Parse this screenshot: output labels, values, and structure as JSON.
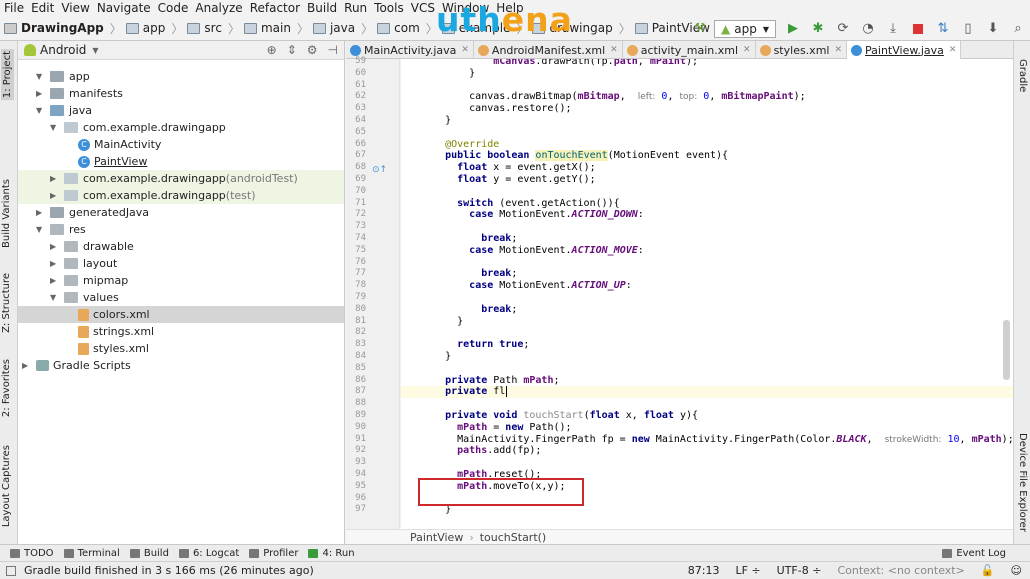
{
  "menubar": [
    "File",
    "Edit",
    "View",
    "Navigate",
    "Code",
    "Analyze",
    "Refactor",
    "Build",
    "Run",
    "Tools",
    "VCS",
    "Window",
    "Help"
  ],
  "breadcrumbs": [
    "DrawingApp",
    "app",
    "src",
    "main",
    "java",
    "com",
    "example",
    "drawingap",
    "PaintView"
  ],
  "logo": {
    "part1": "uth",
    "part2": "ena"
  },
  "run_config": "app",
  "left_tabs": [
    "1: Project",
    "Build Variants",
    "Z: Structure",
    "2: Favorites",
    "Layout Captures"
  ],
  "right_tabs": [
    "Gradle",
    "Device File Explorer"
  ],
  "project": {
    "view_mode": "Android",
    "tree": [
      {
        "label": "app",
        "type": "fold"
      },
      {
        "label": "manifests",
        "type": "fold"
      },
      {
        "label": "java",
        "type": "src"
      },
      {
        "label": "com.example.drawingapp",
        "type": "pkg"
      },
      {
        "label": "MainActivity",
        "type": "class"
      },
      {
        "label": "PaintView",
        "type": "class"
      },
      {
        "label": "com.example.drawingapp",
        "suffix": " (androidTest)",
        "type": "pkg"
      },
      {
        "label": "com.example.drawingapp",
        "suffix": " (test)",
        "type": "pkg"
      },
      {
        "label": "generatedJava",
        "type": "fold"
      },
      {
        "label": "res",
        "type": "res"
      },
      {
        "label": "drawable",
        "type": "res"
      },
      {
        "label": "layout",
        "type": "res"
      },
      {
        "label": "mipmap",
        "type": "res"
      },
      {
        "label": "values",
        "type": "res"
      },
      {
        "label": "colors.xml",
        "type": "xml"
      },
      {
        "label": "strings.xml",
        "type": "xml"
      },
      {
        "label": "styles.xml",
        "type": "xml"
      },
      {
        "label": "Gradle Scripts",
        "type": "gradle"
      }
    ]
  },
  "editor_tabs": [
    {
      "label": "MainActivity.java",
      "color": "#3d8fd9"
    },
    {
      "label": "AndroidManifest.xml",
      "color": "#e8a85a"
    },
    {
      "label": "activity_main.xml",
      "color": "#e8a85a"
    },
    {
      "label": "styles.xml",
      "color": "#e8a85a"
    },
    {
      "label": "PaintView.java",
      "color": "#3d8fd9"
    }
  ],
  "code_lines": [
    {
      "n": "59",
      "t": "            <span class='fld'>mCanvas</span>.drawPath(fp.<span class='fld'>path</span>, <span class='fld'>mPaint</span>);"
    },
    {
      "n": "60",
      "t": "        }"
    },
    {
      "n": "61",
      "t": ""
    },
    {
      "n": "62",
      "t": "        canvas.drawBitmap(<span class='fld'>mBitmap</span>,  <span class='hint'>left:</span> <span class='num'>0</span>, <span class='hint'>top:</span> <span class='num'>0</span>, <span class='fld'>mBitmapPaint</span>);"
    },
    {
      "n": "63",
      "t": "        canvas.restore();"
    },
    {
      "n": "64",
      "t": "    }"
    },
    {
      "n": "65",
      "t": ""
    },
    {
      "n": "66",
      "t": "    <span class='ann'>@Override</span>"
    },
    {
      "n": "67",
      "t": "    <span class='kw'>public boolean</span> <span class='mthd'>onTouchEvent</span>(MotionEvent event){"
    },
    {
      "n": "68",
      "t": "      <span class='kw'>float</span> x = event.getX();"
    },
    {
      "n": "69",
      "t": "      <span class='kw'>float</span> y = event.getY();"
    },
    {
      "n": "70",
      "t": ""
    },
    {
      "n": "71",
      "t": "      <span class='kw'>switch</span> (event.getAction()){"
    },
    {
      "n": "72",
      "t": "        <span class='kw'>case</span> MotionEvent.<span class='fldi'>ACTION_DOWN</span>:"
    },
    {
      "n": "73",
      "t": ""
    },
    {
      "n": "74",
      "t": "          <span class='kw'>break</span>;"
    },
    {
      "n": "75",
      "t": "        <span class='kw'>case</span> MotionEvent.<span class='fldi'>ACTION_MOVE</span>:"
    },
    {
      "n": "76",
      "t": ""
    },
    {
      "n": "77",
      "t": "          <span class='kw'>break</span>;"
    },
    {
      "n": "78",
      "t": "        <span class='kw'>case</span> MotionEvent.<span class='fldi'>ACTION_UP</span>:"
    },
    {
      "n": "79",
      "t": ""
    },
    {
      "n": "80",
      "t": "          <span class='kw'>break</span>;"
    },
    {
      "n": "81",
      "t": "      }"
    },
    {
      "n": "82",
      "t": ""
    },
    {
      "n": "83",
      "t": "      <span class='kw'>return true</span>;"
    },
    {
      "n": "84",
      "t": "    }"
    },
    {
      "n": "85",
      "t": ""
    },
    {
      "n": "86",
      "t": "    <span class='kw'>private</span> Path <span class='fld'>mPath</span>;"
    },
    {
      "n": "87",
      "t": "    <span class='kw'>private</span> fl"
    },
    {
      "n": "88",
      "t": ""
    },
    {
      "n": "89",
      "t": "    <span class='kw'>private void</span> <span class='gray'>touchStart</span>(<span class='kw'>float</span> x, <span class='kw'>float</span> y){"
    },
    {
      "n": "90",
      "t": "      <span class='fld'>mPath</span> = <span class='kw'>new</span> Path();"
    },
    {
      "n": "91",
      "t": "      MainActivity.FingerPath fp = <span class='kw'>new</span> MainActivity.FingerPath(Color.<span class='fldi'>BLACK</span>,  <span class='hint'>strokeWidth:</span> <span class='num'>10</span>, <span class='fld'>mPath</span>);"
    },
    {
      "n": "92",
      "t": "      <span class='fld'>paths</span>.add(fp);"
    },
    {
      "n": "93",
      "t": ""
    },
    {
      "n": "94",
      "t": "      <span class='fld'>mPath</span>.reset();"
    },
    {
      "n": "95",
      "t": "      <span class='fld'>mPath</span>.moveTo(x,y);"
    },
    {
      "n": "96",
      "t": ""
    },
    {
      "n": "97",
      "t": "    }"
    }
  ],
  "editor_breadcrumb": [
    "PaintView",
    "touchStart()"
  ],
  "bottom_tabs": [
    "TODO",
    "Terminal",
    "Build",
    "6: Logcat",
    "Profiler",
    "4: Run"
  ],
  "event_log": "Event Log",
  "status": {
    "message": "Gradle build finished in 3 s 166 ms (26 minutes ago)",
    "position": "87:13",
    "line_sep": "LF ÷",
    "encoding": "UTF-8 ÷",
    "context": "Context: <no context>"
  }
}
